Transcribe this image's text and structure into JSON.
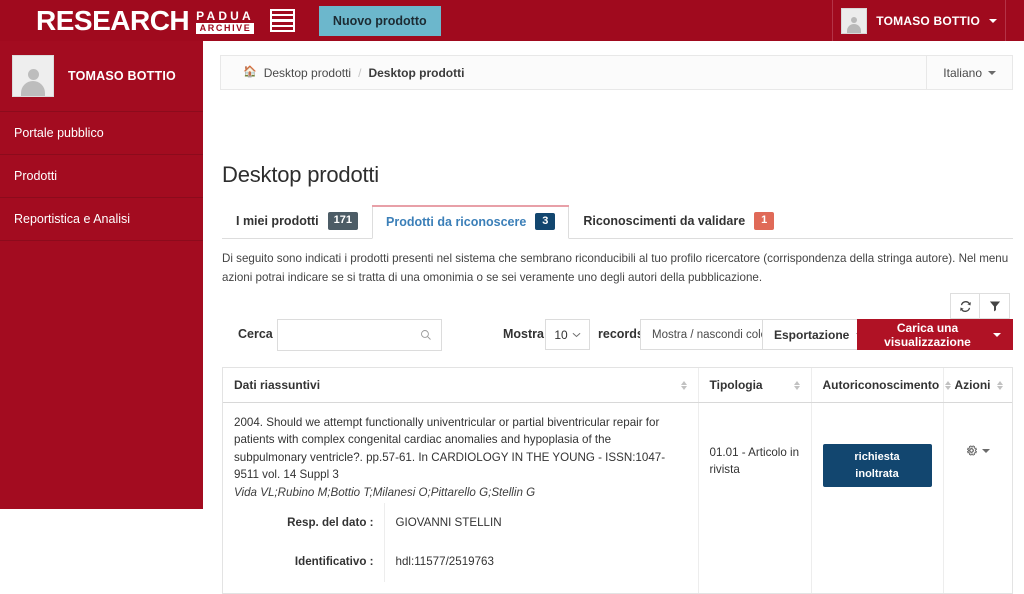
{
  "header": {
    "brand_main": "RESEARCH",
    "brand_sub_top": "PADUA",
    "brand_sub_bottom": "ARCHIVE",
    "menu_icon": "hamburger-icon",
    "new_product_label": "Nuovo prodotto",
    "user_name": "TOMASO BOTTIO",
    "accent_red": "#a00a1e",
    "new_product_bg": "#6cb7cc"
  },
  "sidebar": {
    "user_name": "TOMASO BOTTIO",
    "bg": "#a30c20",
    "items": [
      {
        "label": "Portale pubblico"
      },
      {
        "label": "Prodotti"
      },
      {
        "label": "Reportistica e Analisi"
      }
    ]
  },
  "breadcrumb": {
    "home_icon": "home-icon",
    "first": "Desktop prodotti",
    "separator": "/",
    "current": "Desktop prodotti",
    "language": "Italiano"
  },
  "main": {
    "page_title": "Desktop prodotti",
    "tabs": [
      {
        "label": "I miei prodotti",
        "count": "171",
        "badge_color": "#4c5c66",
        "active": false
      },
      {
        "label": "Prodotti da riconoscere",
        "count": "3",
        "badge_color": "#12466f",
        "active": true
      },
      {
        "label": "Riconoscimenti da validare",
        "count": "1",
        "badge_color": "#e06a58",
        "active": false
      }
    ],
    "description": "Di seguito sono indicati i prodotti presenti nel sistema che sembrano riconducibili al tuo profilo ricercatore (corrispondenza della stringa autore). Nel menu azioni potrai indicare se si tratta di una omonimia o se sei veramente uno degli autori della pubblicazione."
  },
  "toolbar": {
    "refresh_icon": "refresh-icon",
    "filter_icon": "filter-icon",
    "search_label": "Cerca",
    "search_value": "",
    "search_placeholder": "",
    "search_icon": "search-icon",
    "show_label": "Mostra",
    "page_size": "10",
    "records_label": "records",
    "columns_button": "Mostra / nascondi colonne",
    "export_button": "Esportazione",
    "load_view_button": "Carica una visualizzazione",
    "load_view_bg": "#b01225"
  },
  "table": {
    "columns": [
      {
        "label": "Dati riassuntivi",
        "sortable": true
      },
      {
        "label": "Tipologia",
        "sortable": true
      },
      {
        "label": "Autoriconoscimento",
        "sortable": true
      },
      {
        "label": "Azioni",
        "sortable": true
      }
    ],
    "rows": [
      {
        "citation": "2004. Should we attempt functionally univentricular or partial biventricular repair for patients with complex congenital cardiac anomalies and hypoplasia of the subpulmonary ventricle?. pp.57-61. In CARDIOLOGY IN THE YOUNG - ISSN:1047-9511 vol. 14 Suppl 3",
        "authors": "Vida VL;Rubino M;Bottio T;Milanesi O;Pittarello G;Stellin G",
        "resp_key": "Resp. del dato :",
        "resp_value": "GIOVANNI STELLIN",
        "ident_key": "Identificativo :",
        "ident_value": "hdl:11577/2519763",
        "tipologia": "01.01 - Articolo in rivista",
        "autoriconoscimento": "richiesta inoltrata",
        "autoriconoscimento_color": "#12466f",
        "azioni_icon": "gear-icon"
      }
    ]
  }
}
